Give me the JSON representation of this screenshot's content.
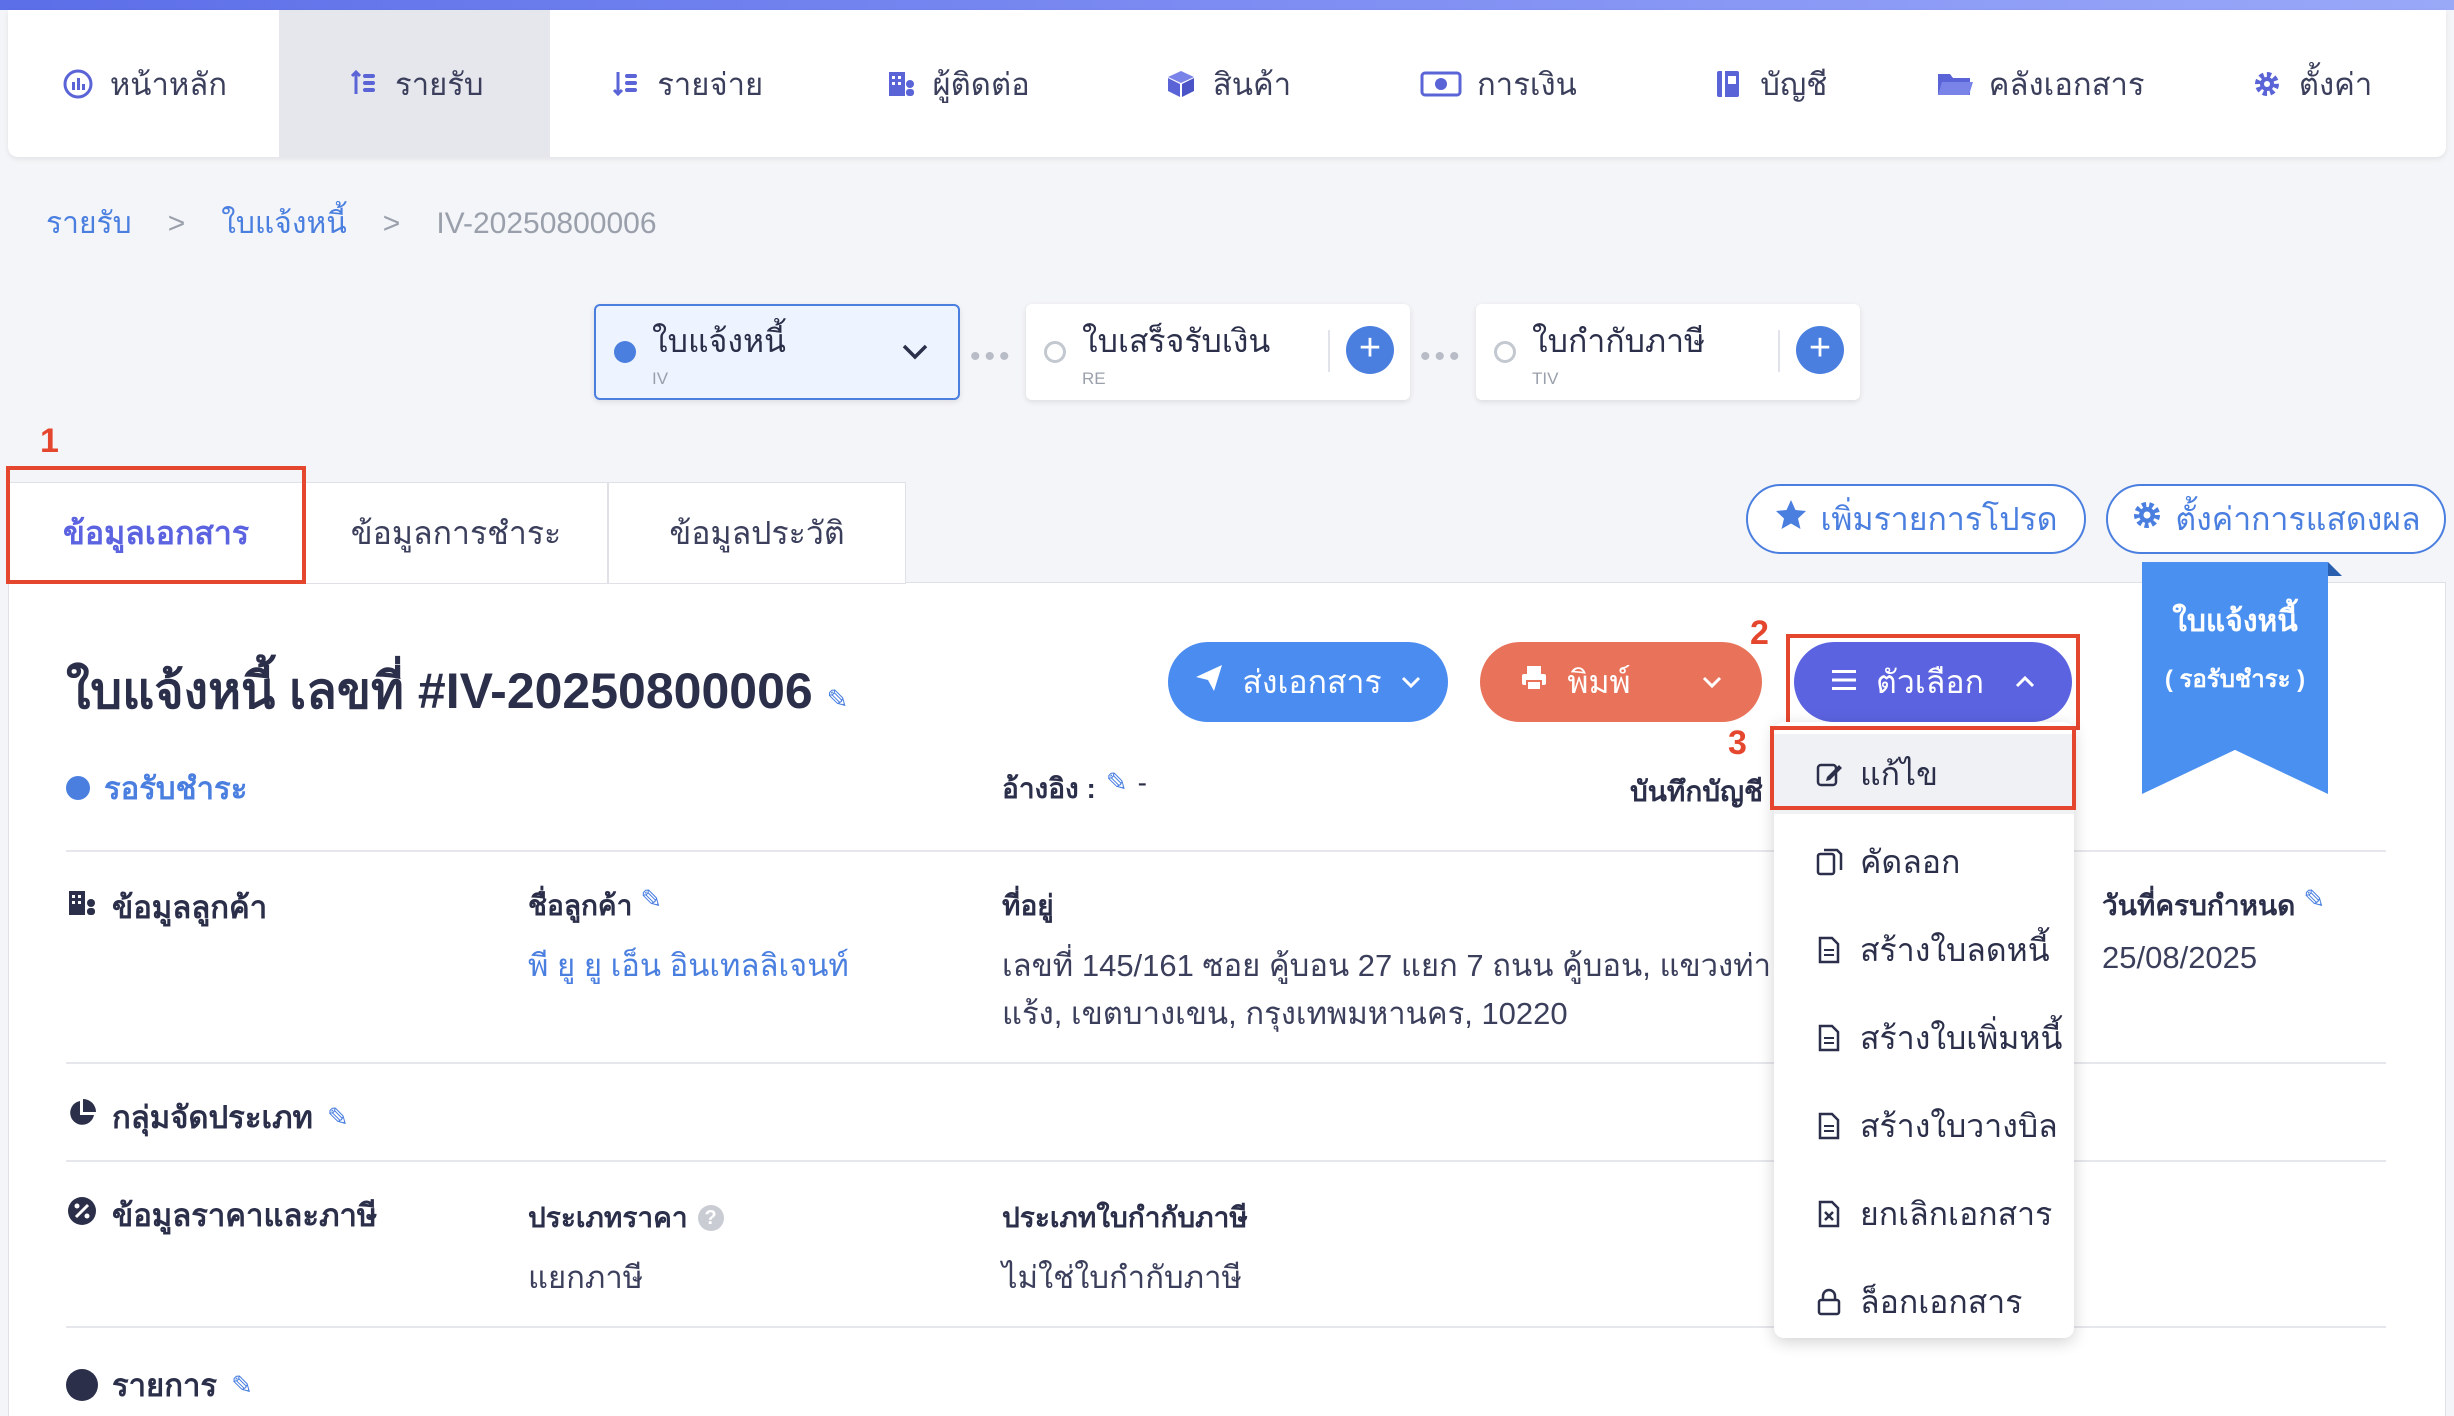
{
  "nav": {
    "items": [
      {
        "label": "หน้าหลัก",
        "icon": "dashboard-icon"
      },
      {
        "label": "รายรับ",
        "icon": "income-coins-icon",
        "active": true
      },
      {
        "label": "รายจ่าย",
        "icon": "expense-coins-icon"
      },
      {
        "label": "ผู้ติดต่อ",
        "icon": "contacts-building-icon"
      },
      {
        "label": "สินค้า",
        "icon": "product-box-icon"
      },
      {
        "label": "การเงิน",
        "icon": "money-icon"
      },
      {
        "label": "บัญชี",
        "icon": "ledger-book-icon"
      },
      {
        "label": "คลังเอกสาร",
        "icon": "folder-icon"
      },
      {
        "label": "ตั้งค่า",
        "icon": "gear-icon"
      }
    ]
  },
  "breadcrumb": {
    "level1": "รายรับ",
    "sep": ">",
    "level2": "ใบแจ้งหนี้",
    "current": "IV-20250800006"
  },
  "flow": {
    "step1": {
      "label": "ใบแจ้งหนี้",
      "code": "IV"
    },
    "step2": {
      "label": "ใบเสร็จรับเงิน",
      "code": "RE"
    },
    "step3": {
      "label": "ใบกำกับภาษี",
      "code": "TIV"
    },
    "connector": "•••",
    "plus": "+"
  },
  "tabs": [
    "ข้อมูลเอกสาร",
    "ข้อมูลการชำระ",
    "ข้อมูลประวัติ"
  ],
  "annotations": {
    "n1": "1",
    "n2": "2",
    "n3": "3"
  },
  "actions": {
    "favorite": "เพิ่มรายการโปรด",
    "display_settings": "ตั้งค่าการแสดงผล"
  },
  "ribbon": {
    "line1": "ใบแจ้งหนี้",
    "line2": "( รอรับชำระ )"
  },
  "doc": {
    "title": "ใบแจ้งหนี้ เลขที่ #IV-20250800006",
    "status": "รอรับชำระ",
    "send_label": "ส่งเอกสาร",
    "print_label": "พิมพ์",
    "options_label": "ตัวเลือก",
    "reference_label": "อ้างอิง :",
    "reference_value": "-",
    "journal_label": "บันทึกบัญชี :"
  },
  "customer": {
    "section": "ข้อมูลลูกค้า",
    "name_label": "ชื่อลูกค้า",
    "name": "พี ยู ยู เอ็น อินเทลลิเจนท์",
    "address_label": "ที่อยู่",
    "address_line1": "เลขที่ 145/161 ซอย คู้บอน 27 แยก 7 ถนน คู้บอน, แขวงท่า",
    "address_line2": "แร้ง, เขตบางเขน, กรุงเทพมหานคร, 10220",
    "due_label": "วันที่ครบกำหนด",
    "due_date": "25/08/2025"
  },
  "group": {
    "section": "กลุ่มจัดประเภท"
  },
  "pricing": {
    "section": "ข้อมูลราคาและภาษี",
    "price_type_label": "ประเภทราคา",
    "price_type_value": "แยกภาษี",
    "tax_invoice_label": "ประเภทใบกำกับภาษี",
    "tax_invoice_value": "ไม่ใช่ใบกำกับภาษี"
  },
  "items": {
    "section": "รายการ"
  },
  "menu": [
    {
      "label": "แก้ไข",
      "icon": "edit-icon"
    },
    {
      "label": "คัดลอก",
      "icon": "copy-icon"
    },
    {
      "label": "สร้างใบลดหนี้",
      "icon": "document-icon"
    },
    {
      "label": "สร้างใบเพิ่มหนี้",
      "icon": "document-icon"
    },
    {
      "label": "สร้างใบวางบิล",
      "icon": "document-icon"
    },
    {
      "label": "ยกเลิกเอกสาร",
      "icon": "cancel-document-icon"
    },
    {
      "label": "ล็อกเอกสาร",
      "icon": "lock-icon"
    }
  ],
  "colors": {
    "primary": "#4a7fe0",
    "accent": "#5b63e0",
    "print": "#e8735a",
    "annotation": "#e5462e"
  }
}
